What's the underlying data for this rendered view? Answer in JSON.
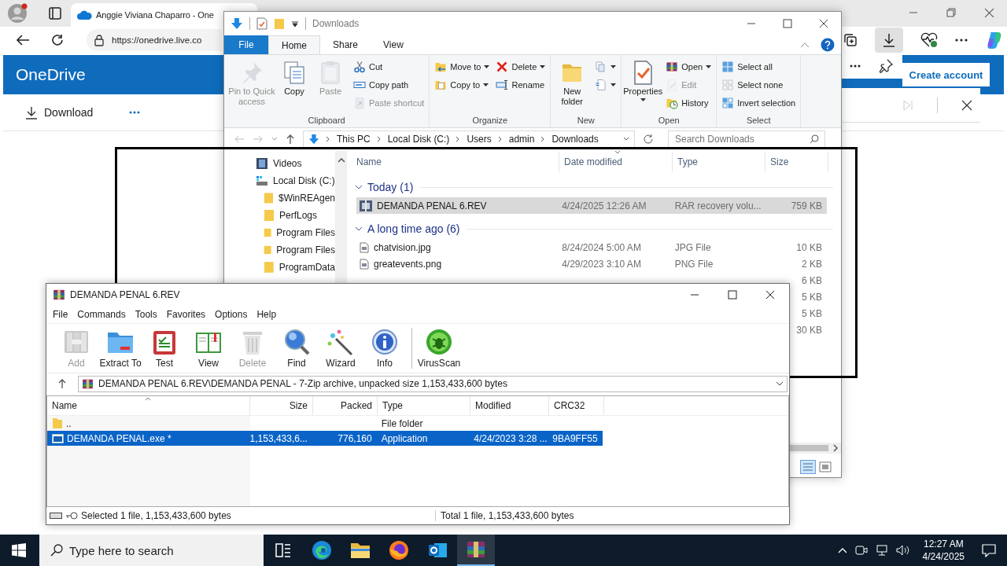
{
  "browser": {
    "tabs": [
      {
        "title": "Anggie Viviana Chaparro - One",
        "selected": true
      }
    ],
    "url": "https://onedrive.live.co",
    "page": {
      "brand": "OneDrive",
      "create_account": "Create account",
      "toolbar": [
        {
          "label": "Download"
        }
      ]
    }
  },
  "explorer": {
    "title": "Downloads",
    "tabs": [
      {
        "label": "File",
        "kind": "file",
        "selected": false
      },
      {
        "label": "Home",
        "kind": "tab",
        "selected": true
      },
      {
        "label": "Share",
        "kind": "tab",
        "selected": false
      },
      {
        "label": "View",
        "kind": "tab",
        "selected": false
      }
    ],
    "ribbon": [
      {
        "label": "Clipboard",
        "columns": [
          {
            "kind": "large",
            "items": [
              {
                "label": "Pin to Quick access",
                "disabled": true,
                "dropdown": false
              },
              {
                "label": "Copy",
                "disabled": false,
                "dropdown": false
              },
              {
                "label": "Paste",
                "disabled": true,
                "dropdown": false
              }
            ]
          },
          {
            "kind": "small",
            "items": [
              {
                "label": "Cut",
                "disabled": false,
                "dropdown": false
              },
              {
                "label": "Copy path",
                "disabled": false,
                "dropdown": false
              },
              {
                "label": "Paste shortcut",
                "disabled": true,
                "dropdown": false
              }
            ]
          }
        ]
      },
      {
        "label": "Organize",
        "columns": [
          {
            "kind": "small",
            "items": [
              {
                "label": "Move to",
                "disabled": false,
                "dropdown": true
              },
              {
                "label": "Copy to",
                "disabled": false,
                "dropdown": true
              }
            ]
          },
          {
            "kind": "small",
            "items": [
              {
                "label": "Delete",
                "disabled": false,
                "dropdown": true
              },
              {
                "label": "Rename",
                "disabled": false,
                "dropdown": false
              }
            ]
          }
        ]
      },
      {
        "label": "New",
        "columns": [
          {
            "kind": "large",
            "items": [
              {
                "label": "New folder",
                "disabled": false,
                "dropdown": false
              }
            ]
          },
          {
            "kind": "small",
            "items": [
              {
                "disabled": false,
                "dropdown": true
              },
              {
                "disabled": false,
                "dropdown": true
              }
            ]
          }
        ]
      },
      {
        "label": "Open",
        "columns": [
          {
            "kind": "large",
            "items": [
              {
                "label": "Properties",
                "disabled": false,
                "dropdown": true
              }
            ]
          },
          {
            "kind": "small",
            "items": [
              {
                "label": "Open",
                "disabled": false,
                "dropdown": true
              },
              {
                "label": "Edit",
                "disabled": true,
                "dropdown": false
              },
              {
                "label": "History",
                "disabled": false,
                "dropdown": false
              }
            ]
          }
        ]
      },
      {
        "label": "Select",
        "columns": [
          {
            "kind": "small",
            "items": [
              {
                "label": "Select all",
                "disabled": false,
                "dropdown": false
              },
              {
                "label": "Select none",
                "disabled": false,
                "dropdown": false
              },
              {
                "label": "Invert selection",
                "disabled": false,
                "dropdown": false
              }
            ]
          }
        ]
      }
    ],
    "address": [
      "This PC",
      "Local Disk (C:)",
      "Users",
      "admin",
      "Downloads"
    ],
    "search": {
      "placeholder": "Search Downloads"
    },
    "nav": [
      {
        "label": "Videos",
        "kind": "videos"
      },
      {
        "label": "Local Disk (C:)",
        "kind": "drive",
        "children": [
          {
            "label": "$WinREAgen",
            "kind": "folder"
          },
          {
            "label": "PerfLogs",
            "kind": "folder"
          },
          {
            "label": "Program Files",
            "kind": "folder"
          },
          {
            "label": "Program Files",
            "kind": "folder"
          },
          {
            "label": "ProgramData",
            "kind": "folder"
          }
        ]
      }
    ],
    "columns": [
      "Name",
      "Date modified",
      "Type",
      "Size"
    ],
    "groups": [
      {
        "label": "Today (1)",
        "expanded": true,
        "files": [
          {
            "name": "DEMANDA PENAL 6.REV",
            "kind": "rar",
            "date": "4/24/2025 12:26 AM",
            "type": "RAR recovery volu...",
            "size": "759 KB",
            "selected": true
          }
        ]
      },
      {
        "label": "A long time ago (6)",
        "expanded": true,
        "files": [
          {
            "name": "chatvision.jpg",
            "kind": "image",
            "date": "8/24/2024 5:00 AM",
            "type": "JPG File",
            "size": "10 KB",
            "selected": false
          },
          {
            "name": "greatevents.png",
            "kind": "image",
            "date": "4/29/2023 3:10 AM",
            "type": "PNG File",
            "size": "2 KB",
            "selected": false
          },
          {
            "size": "6 KB",
            "selected": false
          },
          {
            "size": "5 KB",
            "selected": false
          },
          {
            "size": "5 KB",
            "selected": false
          },
          {
            "size": "30 KB",
            "selected": false
          }
        ]
      }
    ]
  },
  "winrar": {
    "title": "DEMANDA PENAL 6.REV",
    "menu": [
      "File",
      "Commands",
      "Tools",
      "Favorites",
      "Options",
      "Help"
    ],
    "toolbar": [
      [
        {
          "label": "Add",
          "disabled": true
        },
        {
          "label": "Extract To",
          "disabled": false
        },
        {
          "label": "Test",
          "disabled": false
        },
        {
          "label": "View",
          "disabled": false
        },
        {
          "label": "Delete",
          "disabled": true
        },
        {
          "label": "Find",
          "disabled": false
        },
        {
          "label": "Wizard",
          "disabled": false
        },
        {
          "label": "Info",
          "disabled": false
        }
      ],
      [
        {
          "label": "VirusScan",
          "disabled": false
        }
      ]
    ],
    "path": "DEMANDA PENAL 6.REV\\DEMANDA PENAL - 7-Zip archive, unpacked size 1,153,433,600 bytes",
    "columns": [
      "Name",
      "Size",
      "Packed",
      "Type",
      "Modified",
      "CRC32"
    ],
    "rows": [
      {
        "kind": "folder",
        "selected": false,
        "cells": [
          "..",
          "",
          "",
          "File folder",
          "",
          ""
        ]
      },
      {
        "kind": "exe",
        "selected": true,
        "cells": [
          "DEMANDA PENAL.exe *",
          "1,153,433,6...",
          "776,160",
          "Application",
          "4/24/2023 3:28 ...",
          "9BA9FF55"
        ]
      }
    ],
    "status": [
      "Selected 1 file, 1,153,433,600 bytes",
      "Total 1 file, 1,153,433,600 bytes"
    ]
  },
  "taskbar": {
    "search": {
      "placeholder": "Type here to search"
    },
    "apps": [
      {
        "kind": "taskview",
        "active": false
      },
      {
        "kind": "edge",
        "active": false
      },
      {
        "kind": "explorer",
        "active": false
      },
      {
        "kind": "firefox",
        "active": false
      },
      {
        "kind": "outlook",
        "active": false
      },
      {
        "kind": "winrar",
        "active": true
      }
    ],
    "time": "12:27 AM",
    "date": "4/24/2025"
  }
}
